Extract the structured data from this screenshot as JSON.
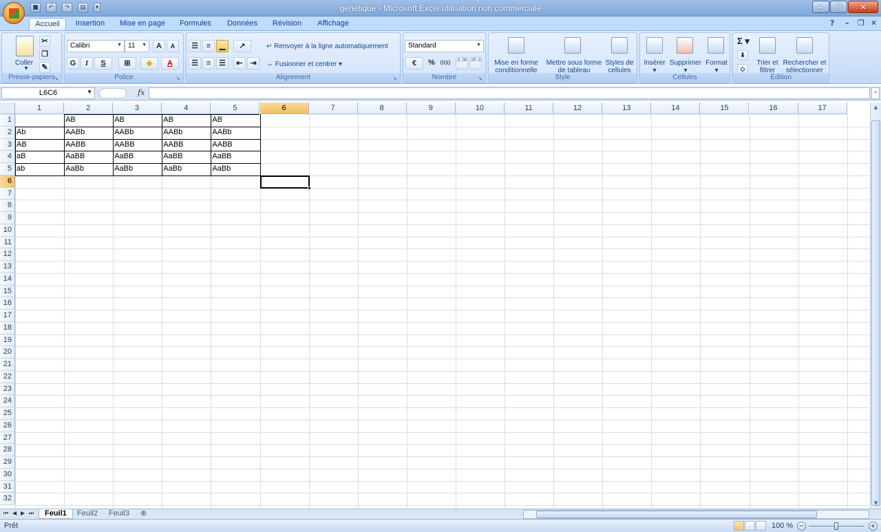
{
  "window": {
    "title": "génétique - Microsoft Excel utilisation non commerciale"
  },
  "ribbon_tabs": [
    "Accueil",
    "Insertion",
    "Mise en page",
    "Formules",
    "Données",
    "Révision",
    "Affichage"
  ],
  "clipboard": {
    "paste_label": "Coller",
    "group_label": "Presse-papiers"
  },
  "font": {
    "name": "Calibri",
    "size": "11",
    "bold": "G",
    "italic": "I",
    "underline": "S",
    "grow": "A",
    "shrink": "A",
    "color_letter": "A",
    "group_label": "Police"
  },
  "alignment": {
    "wrap_label": "Renvoyer à la ligne automatiquement",
    "merge_label": "Fusionner et centrer",
    "group_label": "Alignement"
  },
  "number": {
    "format": "Standard",
    "percent": "%",
    "thousands": "000",
    "inc_decimal": ",0 ,00",
    "dec_decimal": ",00 ,0",
    "group_label": "Nombre"
  },
  "style": {
    "conditional_label_1": "Mise en forme",
    "conditional_label_2": "conditionnelle",
    "table_label_1": "Mettre sous forme",
    "table_label_2": "de tableau",
    "cell_styles_label_1": "Styles de",
    "cell_styles_label_2": "cellules",
    "group_label": "Style"
  },
  "cells": {
    "insert_label": "Insérer",
    "delete_label": "Supprimer",
    "format_label": "Format",
    "group_label": "Cellules"
  },
  "editing": {
    "sum_symbol": "Σ",
    "sort_label_1": "Trier et",
    "sort_label_2": "filtrer",
    "find_label_1": "Rechercher et",
    "find_label_2": "sélectionner",
    "group_label": "Édition"
  },
  "formula_bar": {
    "name_box": "L6C6",
    "fx": "fx",
    "content": ""
  },
  "columns": [
    "1",
    "2",
    "3",
    "4",
    "5",
    "6",
    "7",
    "8",
    "9",
    "10",
    "11",
    "12",
    "13",
    "14",
    "15",
    "16",
    "17"
  ],
  "rows": [
    "1",
    "2",
    "3",
    "4",
    "5",
    "6",
    "7",
    "8",
    "9",
    "10",
    "11",
    "12",
    "13",
    "14",
    "15",
    "16",
    "17",
    "18",
    "19",
    "20",
    "21",
    "22",
    "23",
    "24",
    "25",
    "26",
    "27",
    "28",
    "29",
    "30",
    "31",
    "32"
  ],
  "selected": {
    "row": "6",
    "col": "6"
  },
  "table": [
    [
      "",
      "AB",
      "AB",
      "AB",
      "AB"
    ],
    [
      "Ab",
      "AABb",
      "AABb",
      "AABb",
      "AABb"
    ],
    [
      "AB",
      "AABB",
      "AABB",
      "AABB",
      "AABB"
    ],
    [
      "aB",
      "AaBB",
      "AaBB",
      "AaBB",
      "AaBB"
    ],
    [
      "ab",
      "AaBb",
      "AaBb",
      "AaBb",
      "AaBb"
    ]
  ],
  "sheets": [
    "Feuil1",
    "Feuil2",
    "Feuil3"
  ],
  "active_sheet": "Feuil1",
  "status": {
    "ready": "Prêt",
    "zoom": "100 %"
  }
}
